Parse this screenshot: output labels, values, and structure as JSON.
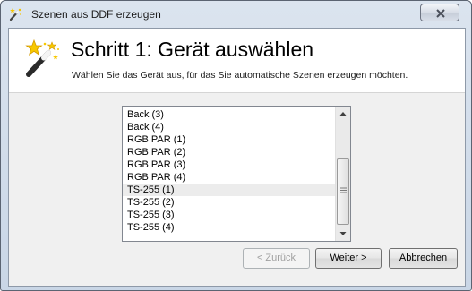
{
  "window": {
    "title": "Szenen aus DDF erzeugen",
    "title_icon": "magic-wand-icon",
    "close_icon": "close-icon"
  },
  "header": {
    "title": "Schritt 1: Gerät auswählen",
    "subtitle": "Wählen Sie das Gerät aus, für das Sie automatische Szenen erzeugen möchten.",
    "icon": "magic-wand-icon"
  },
  "device_list": {
    "items": [
      "Back (3)",
      "Back (4)",
      "RGB PAR (1)",
      "RGB PAR (2)",
      "RGB PAR (3)",
      "RGB PAR (4)",
      "TS-255 (1)",
      "TS-255 (2)",
      "TS-255 (3)",
      "TS-255 (4)"
    ],
    "hovered_index": 6
  },
  "buttons": {
    "back": "< Zurück",
    "next": "Weiter >",
    "cancel": "Abbrechen"
  },
  "colors": {
    "hover_row": "#ececec",
    "window_frame": "#c9d6e6",
    "dialog_bg": "#f0f0f0"
  }
}
